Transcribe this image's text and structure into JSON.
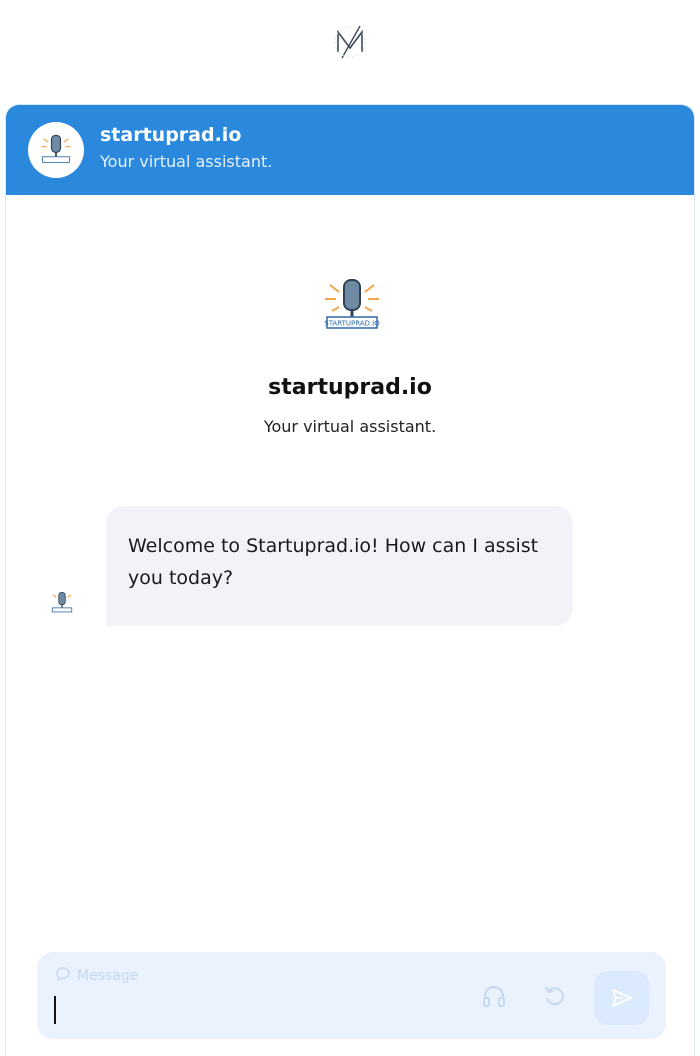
{
  "header": {
    "title": "startuprad.io",
    "subtitle": "Your virtual assistant.",
    "brand_color": "#2a88dd",
    "logo_text": "STARTUPRAD.IO"
  },
  "hero": {
    "title": "startuprad.io",
    "subtitle": "Your virtual assistant."
  },
  "messages": [
    {
      "sender": "bot",
      "text": "Welcome to Startuprad.io! How can I assist you today?"
    }
  ],
  "composer": {
    "placeholder": "Message",
    "icons": [
      "chat-bubble-icon",
      "headset-icon",
      "refresh-icon",
      "send-icon"
    ]
  },
  "colors": {
    "bubble_bg": "#f3f2f8",
    "composer_bg": "#e9f2fd",
    "send_bg": "#dbeafc"
  }
}
